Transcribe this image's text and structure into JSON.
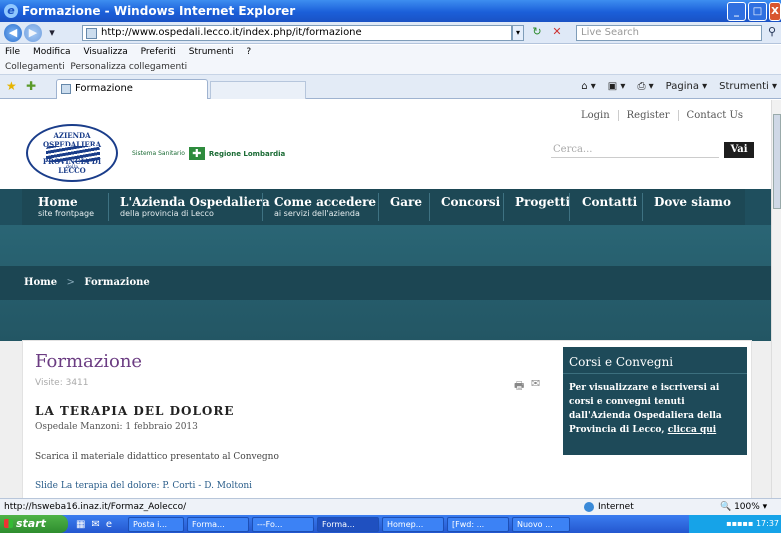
{
  "window": {
    "title": "Formazione - Windows Internet Explorer",
    "min": "_",
    "max": "□",
    "close": "X"
  },
  "addressbar": {
    "url": "http://www.ospedali.lecco.it/index.php/it/formazione",
    "search_placeholder": "Live Search"
  },
  "menubar": [
    "File",
    "Modifica",
    "Visualizza",
    "Preferiti",
    "Strumenti",
    "?"
  ],
  "linksbar": {
    "label": "Collegamenti",
    "link": "Personalizza collegamenti"
  },
  "tabs": {
    "active": "Formazione"
  },
  "commandbar": [
    "Pagina ▾",
    "Strumenti ▾"
  ],
  "site": {
    "logo": {
      "top": "AZIENDA OSPEDALIERA",
      "middle": "della",
      "bottom": "PROVINCIA DI LECCO"
    },
    "partner": {
      "prefix": "Sistema Sanitario",
      "name": "Regione Lombardia"
    },
    "toplinks": [
      "Login",
      "Register",
      "Contact Us"
    ],
    "search_placeholder": "Cerca...",
    "search_button": "Vai",
    "nav": [
      {
        "main": "Home",
        "sub": "site frontpage"
      },
      {
        "main": "L'Azienda Ospedaliera",
        "sub": "della provincia di Lecco"
      },
      {
        "main": "Come accedere",
        "sub": "ai servizi dell'azienda"
      },
      {
        "main": "Gare",
        "sub": ""
      },
      {
        "main": "Concorsi",
        "sub": ""
      },
      {
        "main": "Progetti",
        "sub": ""
      },
      {
        "main": "Contatti",
        "sub": ""
      },
      {
        "main": "Dove siamo",
        "sub": ""
      }
    ],
    "breadcrumb": [
      "Home",
      "Formazione"
    ],
    "article": {
      "title": "Formazione",
      "visits": "Visite: 3411",
      "heading": "LA TERAPIA DEL DOLORE",
      "subheading": "Ospedale Manzoni: 1 febbraio 2013",
      "text": "Scarica il materiale didattico presentato al Convegno",
      "link": "Slide La terapia del dolore: P. Corti - D. Moltoni"
    },
    "sidebar": {
      "title": "Corsi e Convegni",
      "body": "Per visualizzare e iscriversi  ai corsi e convegni tenuti dall'Azienda Ospedaliera della Provincia di Lecco,",
      "link": "clicca qui"
    }
  },
  "statusbar": {
    "url": "http://hsweba16.inaz.it/Formaz_Aolecco/",
    "zone": "Internet",
    "zoom": "100%"
  },
  "taskbar": {
    "start": "start",
    "buttons": [
      "Posta i...",
      "Forma...",
      "---Fo...",
      "Forma...",
      "Homep...",
      "[Fwd: ...",
      "Nuovo ..."
    ],
    "clock": "17:37"
  }
}
